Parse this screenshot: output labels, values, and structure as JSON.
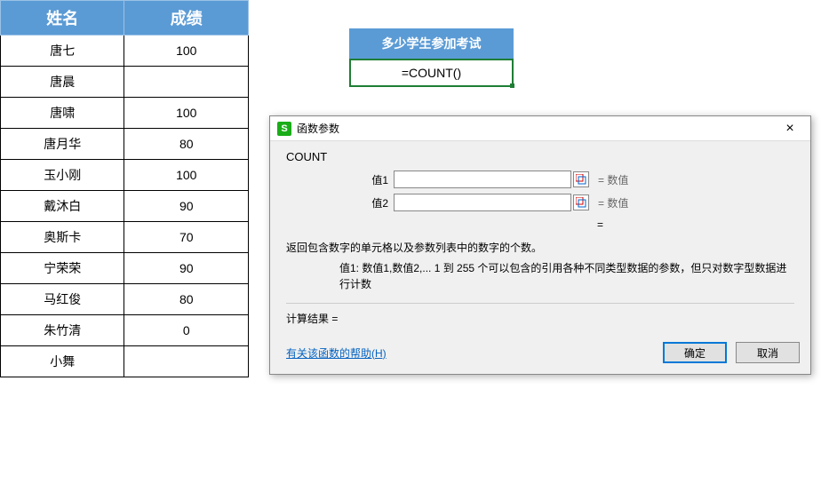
{
  "table": {
    "headers": {
      "name": "姓名",
      "score": "成绩"
    },
    "rows": [
      {
        "name": "唐七",
        "score": "100"
      },
      {
        "name": "唐晨",
        "score": ""
      },
      {
        "name": "唐啸",
        "score": "100"
      },
      {
        "name": "唐月华",
        "score": "80"
      },
      {
        "name": "玉小刚",
        "score": "100"
      },
      {
        "name": "戴沐白",
        "score": "90"
      },
      {
        "name": "奥斯卡",
        "score": "70"
      },
      {
        "name": "宁荣荣",
        "score": "90"
      },
      {
        "name": "马红俊",
        "score": "80"
      },
      {
        "name": "朱竹清",
        "score": "0"
      },
      {
        "name": "小舞",
        "score": ""
      }
    ]
  },
  "formula": {
    "header": "多少学生参加考试",
    "cell": "=COUNT()"
  },
  "dialog": {
    "icon_letter": "S",
    "title": "函数参数",
    "close": "×",
    "func_name": "COUNT",
    "args": [
      {
        "label": "值1",
        "value": "",
        "hint": "= 数值"
      },
      {
        "label": "值2",
        "value": "",
        "hint": "= 数值"
      }
    ],
    "result_eq": "=",
    "description": "返回包含数字的单元格以及参数列表中的数字的个数。",
    "arg_desc_label": "值1:",
    "arg_desc_text": "数值1,数值2,... 1 到 255 个可以包含的引用各种不同类型数据的参数，但只对数字型数据进行计数",
    "calc_result": "计算结果 =",
    "help_link": "有关该函数的帮助(H)",
    "ok": "确定",
    "cancel": "取消"
  }
}
